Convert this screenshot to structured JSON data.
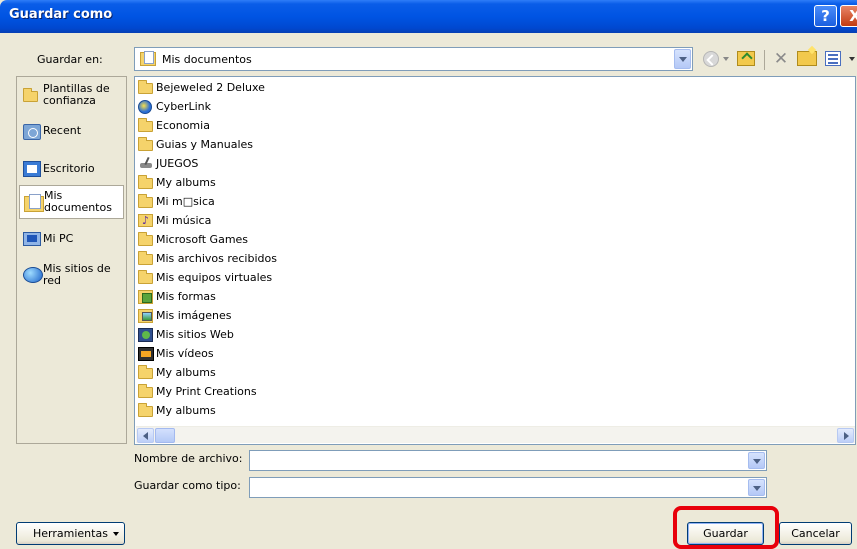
{
  "window": {
    "title": "Guardar como",
    "help_glyph": "?",
    "close_glyph": "X"
  },
  "save_in": {
    "label": "Guardar en:",
    "value": "Mis documentos"
  },
  "toolbar": {
    "icons": [
      "back-icon",
      "up-folder-icon",
      "delete-icon",
      "new-folder-icon",
      "views-icon"
    ],
    "delete_glyph": "✕"
  },
  "places": [
    {
      "label": "Plantillas de confianza",
      "icon": "folder-icon"
    },
    {
      "label": "Recent",
      "icon": "recent-icon"
    },
    {
      "label": "Escritorio",
      "icon": "desktop-icon"
    },
    {
      "label": "Mis documentos",
      "icon": "my-documents-icon",
      "selected": true
    },
    {
      "label": "Mi PC",
      "icon": "my-computer-icon"
    },
    {
      "label": "Mis sitios de red",
      "icon": "network-places-icon"
    }
  ],
  "files": [
    {
      "name": "Bejeweled 2 Deluxe",
      "icon": "folder-icon"
    },
    {
      "name": "CyberLink",
      "icon": "cyberlink-icon"
    },
    {
      "name": "Economia",
      "icon": "folder-icon"
    },
    {
      "name": "Guias y Manuales",
      "icon": "folder-icon"
    },
    {
      "name": "JUEGOS",
      "icon": "joystick-icon"
    },
    {
      "name": "My albums",
      "icon": "folder-icon"
    },
    {
      "name": "Mi m□sica",
      "icon": "folder-icon"
    },
    {
      "name": "Mi música",
      "icon": "music-folder-icon"
    },
    {
      "name": "Microsoft Games",
      "icon": "folder-icon"
    },
    {
      "name": "Mis archivos recibidos",
      "icon": "folder-icon"
    },
    {
      "name": "Mis equipos virtuales",
      "icon": "folder-icon"
    },
    {
      "name": "Mis formas",
      "icon": "forms-folder-icon"
    },
    {
      "name": "Mis imágenes",
      "icon": "images-folder-icon"
    },
    {
      "name": "Mis sitios Web",
      "icon": "web-folder-icon"
    },
    {
      "name": "Mis vídeos",
      "icon": "video-folder-icon"
    },
    {
      "name": "My albums",
      "icon": "folder-icon"
    },
    {
      "name": "My Print Creations",
      "icon": "folder-icon"
    },
    {
      "name": "My albums",
      "icon": "folder-icon"
    }
  ],
  "filename": {
    "label": "Nombre de archivo:",
    "value": ""
  },
  "filetype": {
    "label": "Guardar como tipo:",
    "value": ""
  },
  "buttons": {
    "tools": "Herramientas",
    "save": "Guardar",
    "cancel": "Cancelar"
  },
  "colors": {
    "titlebar": "#0054e3",
    "highlight": "#e8000b",
    "dialog_bg": "#ece9d8"
  }
}
